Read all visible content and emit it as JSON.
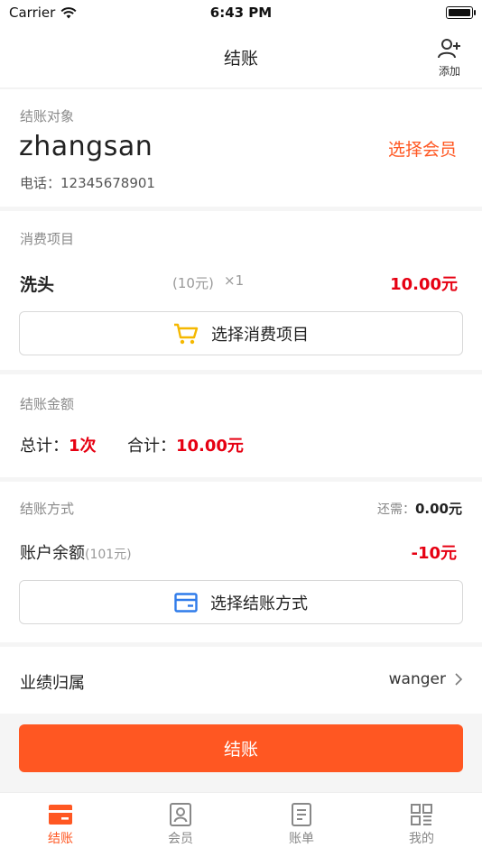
{
  "status_bar": {
    "carrier": "Carrier",
    "time": "6:43 PM"
  },
  "nav": {
    "title": "结账",
    "add_label": "添加"
  },
  "member": {
    "section_label": "结账对象",
    "name": "zhangsan",
    "select_label": "选择会员",
    "phone": "电话：12345678901"
  },
  "items": {
    "section_label": "消费项目",
    "list": [
      {
        "name": "洗头",
        "unit_price": "(10元)",
        "qty": "×1",
        "amount": "10.00元"
      }
    ],
    "select_button": "选择消费项目"
  },
  "summary": {
    "section_label": "结账金额",
    "count_label": "总计：",
    "count_value": "1次",
    "total_label": "合计：",
    "total_value": "10.00元"
  },
  "payment": {
    "section_label": "结账方式",
    "remain_label": "还需：",
    "remain_value": "0.00元",
    "balance_label": "账户余额",
    "balance_sub": "(101元)",
    "balance_amount": "-10元",
    "select_button": "选择结账方式"
  },
  "performance": {
    "label": "业绩归属",
    "value": "wanger"
  },
  "checkout_button": "结账",
  "tabs": [
    {
      "label": "结账",
      "active": true
    },
    {
      "label": "会员",
      "active": false
    },
    {
      "label": "账单",
      "active": false
    },
    {
      "label": "我的",
      "active": false
    }
  ],
  "colors": {
    "accent": "#ff5722",
    "price_red": "#e60012",
    "cart_yellow": "#f5b800",
    "card_blue": "#2f7bea"
  }
}
